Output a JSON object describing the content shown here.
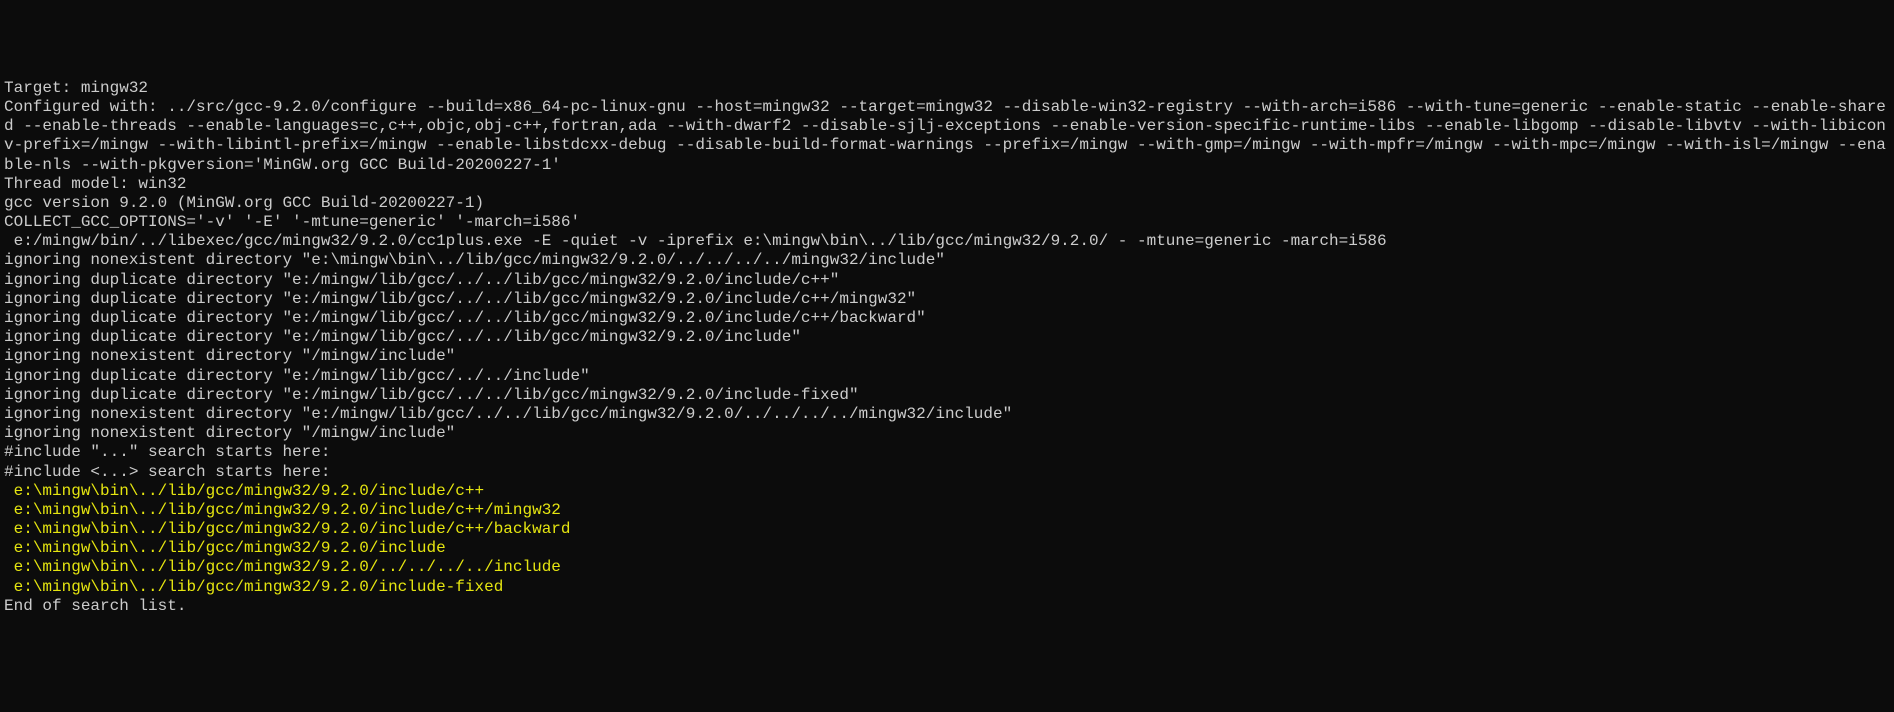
{
  "terminal": {
    "lines": [
      {
        "text": "Target: mingw32",
        "highlight": false
      },
      {
        "text": "Configured with: ../src/gcc-9.2.0/configure --build=x86_64-pc-linux-gnu --host=mingw32 --target=mingw32 --disable-win32-registry --with-arch=i586 --with-tune=generic --enable-static --enable-shared --enable-threads --enable-languages=c,c++,objc,obj-c++,fortran,ada --with-dwarf2 --disable-sjlj-exceptions --enable-version-specific-runtime-libs --enable-libgomp --disable-libvtv --with-libiconv-prefix=/mingw --with-libintl-prefix=/mingw --enable-libstdcxx-debug --disable-build-format-warnings --prefix=/mingw --with-gmp=/mingw --with-mpfr=/mingw --with-mpc=/mingw --with-isl=/mingw --enable-nls --with-pkgversion='MinGW.org GCC Build-20200227-1'",
        "highlight": false
      },
      {
        "text": "Thread model: win32",
        "highlight": false
      },
      {
        "text": "gcc version 9.2.0 (MinGW.org GCC Build-20200227-1)",
        "highlight": false
      },
      {
        "text": "COLLECT_GCC_OPTIONS='-v' '-E' '-mtune=generic' '-march=i586'",
        "highlight": false
      },
      {
        "text": " e:/mingw/bin/../libexec/gcc/mingw32/9.2.0/cc1plus.exe -E -quiet -v -iprefix e:\\mingw\\bin\\../lib/gcc/mingw32/9.2.0/ - -mtune=generic -march=i586",
        "highlight": false
      },
      {
        "text": "ignoring nonexistent directory \"e:\\mingw\\bin\\../lib/gcc/mingw32/9.2.0/../../../../mingw32/include\"",
        "highlight": false
      },
      {
        "text": "ignoring duplicate directory \"e:/mingw/lib/gcc/../../lib/gcc/mingw32/9.2.0/include/c++\"",
        "highlight": false
      },
      {
        "text": "ignoring duplicate directory \"e:/mingw/lib/gcc/../../lib/gcc/mingw32/9.2.0/include/c++/mingw32\"",
        "highlight": false
      },
      {
        "text": "ignoring duplicate directory \"e:/mingw/lib/gcc/../../lib/gcc/mingw32/9.2.0/include/c++/backward\"",
        "highlight": false
      },
      {
        "text": "ignoring duplicate directory \"e:/mingw/lib/gcc/../../lib/gcc/mingw32/9.2.0/include\"",
        "highlight": false
      },
      {
        "text": "ignoring nonexistent directory \"/mingw/include\"",
        "highlight": false
      },
      {
        "text": "ignoring duplicate directory \"e:/mingw/lib/gcc/../../include\"",
        "highlight": false
      },
      {
        "text": "ignoring duplicate directory \"e:/mingw/lib/gcc/../../lib/gcc/mingw32/9.2.0/include-fixed\"",
        "highlight": false
      },
      {
        "text": "ignoring nonexistent directory \"e:/mingw/lib/gcc/../../lib/gcc/mingw32/9.2.0/../../../../mingw32/include\"",
        "highlight": false
      },
      {
        "text": "ignoring nonexistent directory \"/mingw/include\"",
        "highlight": false
      },
      {
        "text": "#include \"...\" search starts here:",
        "highlight": false
      },
      {
        "text": "#include <...> search starts here:",
        "highlight": false
      },
      {
        "text": " e:\\mingw\\bin\\../lib/gcc/mingw32/9.2.0/include/c++",
        "highlight": true
      },
      {
        "text": " e:\\mingw\\bin\\../lib/gcc/mingw32/9.2.0/include/c++/mingw32",
        "highlight": true
      },
      {
        "text": " e:\\mingw\\bin\\../lib/gcc/mingw32/9.2.0/include/c++/backward",
        "highlight": true
      },
      {
        "text": " e:\\mingw\\bin\\../lib/gcc/mingw32/9.2.0/include",
        "highlight": true
      },
      {
        "text": " e:\\mingw\\bin\\../lib/gcc/mingw32/9.2.0/../../../../include",
        "highlight": true
      },
      {
        "text": " e:\\mingw\\bin\\../lib/gcc/mingw32/9.2.0/include-fixed",
        "highlight": true
      },
      {
        "text": "End of search list.",
        "highlight": false
      }
    ]
  }
}
